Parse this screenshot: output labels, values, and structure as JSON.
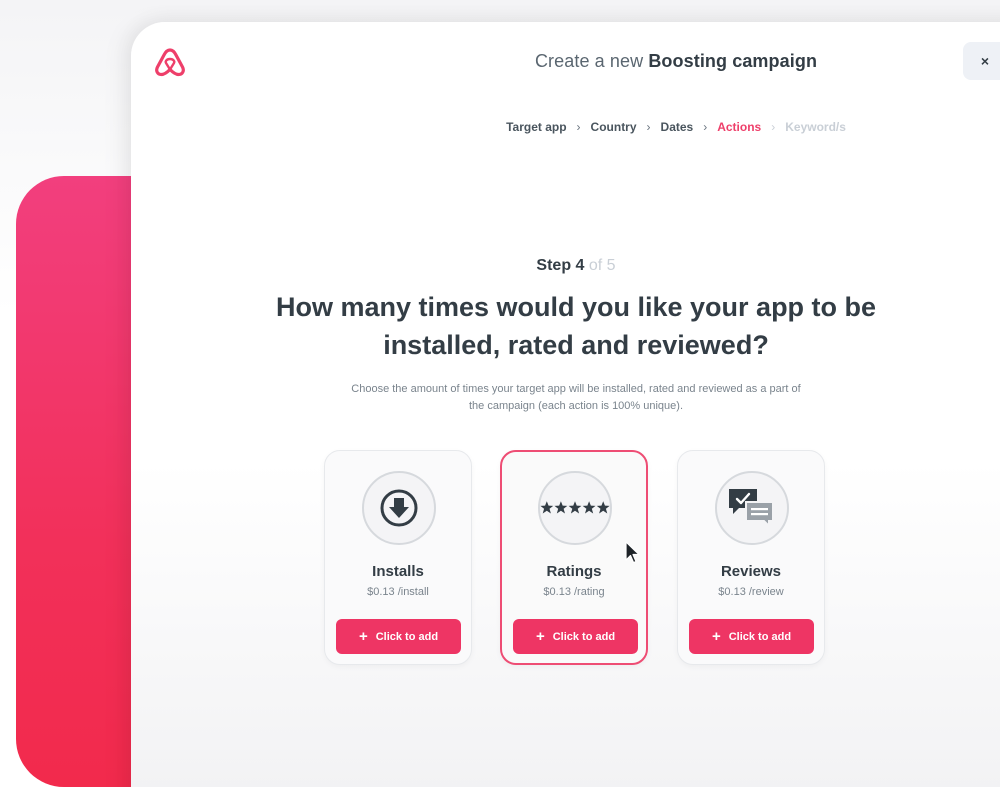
{
  "header": {
    "title_prefix": "Create a new ",
    "title_bold": "Boosting campaign",
    "close_label": "×"
  },
  "breadcrumb": [
    {
      "label": "Target app",
      "state": "done"
    },
    {
      "label": "Country",
      "state": "done"
    },
    {
      "label": "Dates",
      "state": "done"
    },
    {
      "label": "Actions",
      "state": "active"
    },
    {
      "label": "Keyword/s",
      "state": "disabled"
    }
  ],
  "step": {
    "current": "Step 4",
    "total": " of 5"
  },
  "headline": "How many times would you like your app to be installed, rated and reviewed?",
  "subtext": "Choose the amount of times your target app will be installed, rated and reviewed as a part of the campaign (each action is 100% unique).",
  "cards": [
    {
      "label": "Installs",
      "price": "$0.13 /install",
      "button": "Click to add",
      "icon": "download-icon",
      "selected": false
    },
    {
      "label": "Ratings",
      "price": "$0.13 /rating",
      "button": "Click to add",
      "icon": "stars-icon",
      "selected": true
    },
    {
      "label": "Reviews",
      "price": "$0.13 /review",
      "button": "Click to add",
      "icon": "chat-bubbles-icon",
      "selected": false
    }
  ],
  "colors": {
    "accent": "#ee3564",
    "active_crumb": "#ee3f6a",
    "text_dark": "#333d45",
    "pink_panel": "#f2305a"
  }
}
